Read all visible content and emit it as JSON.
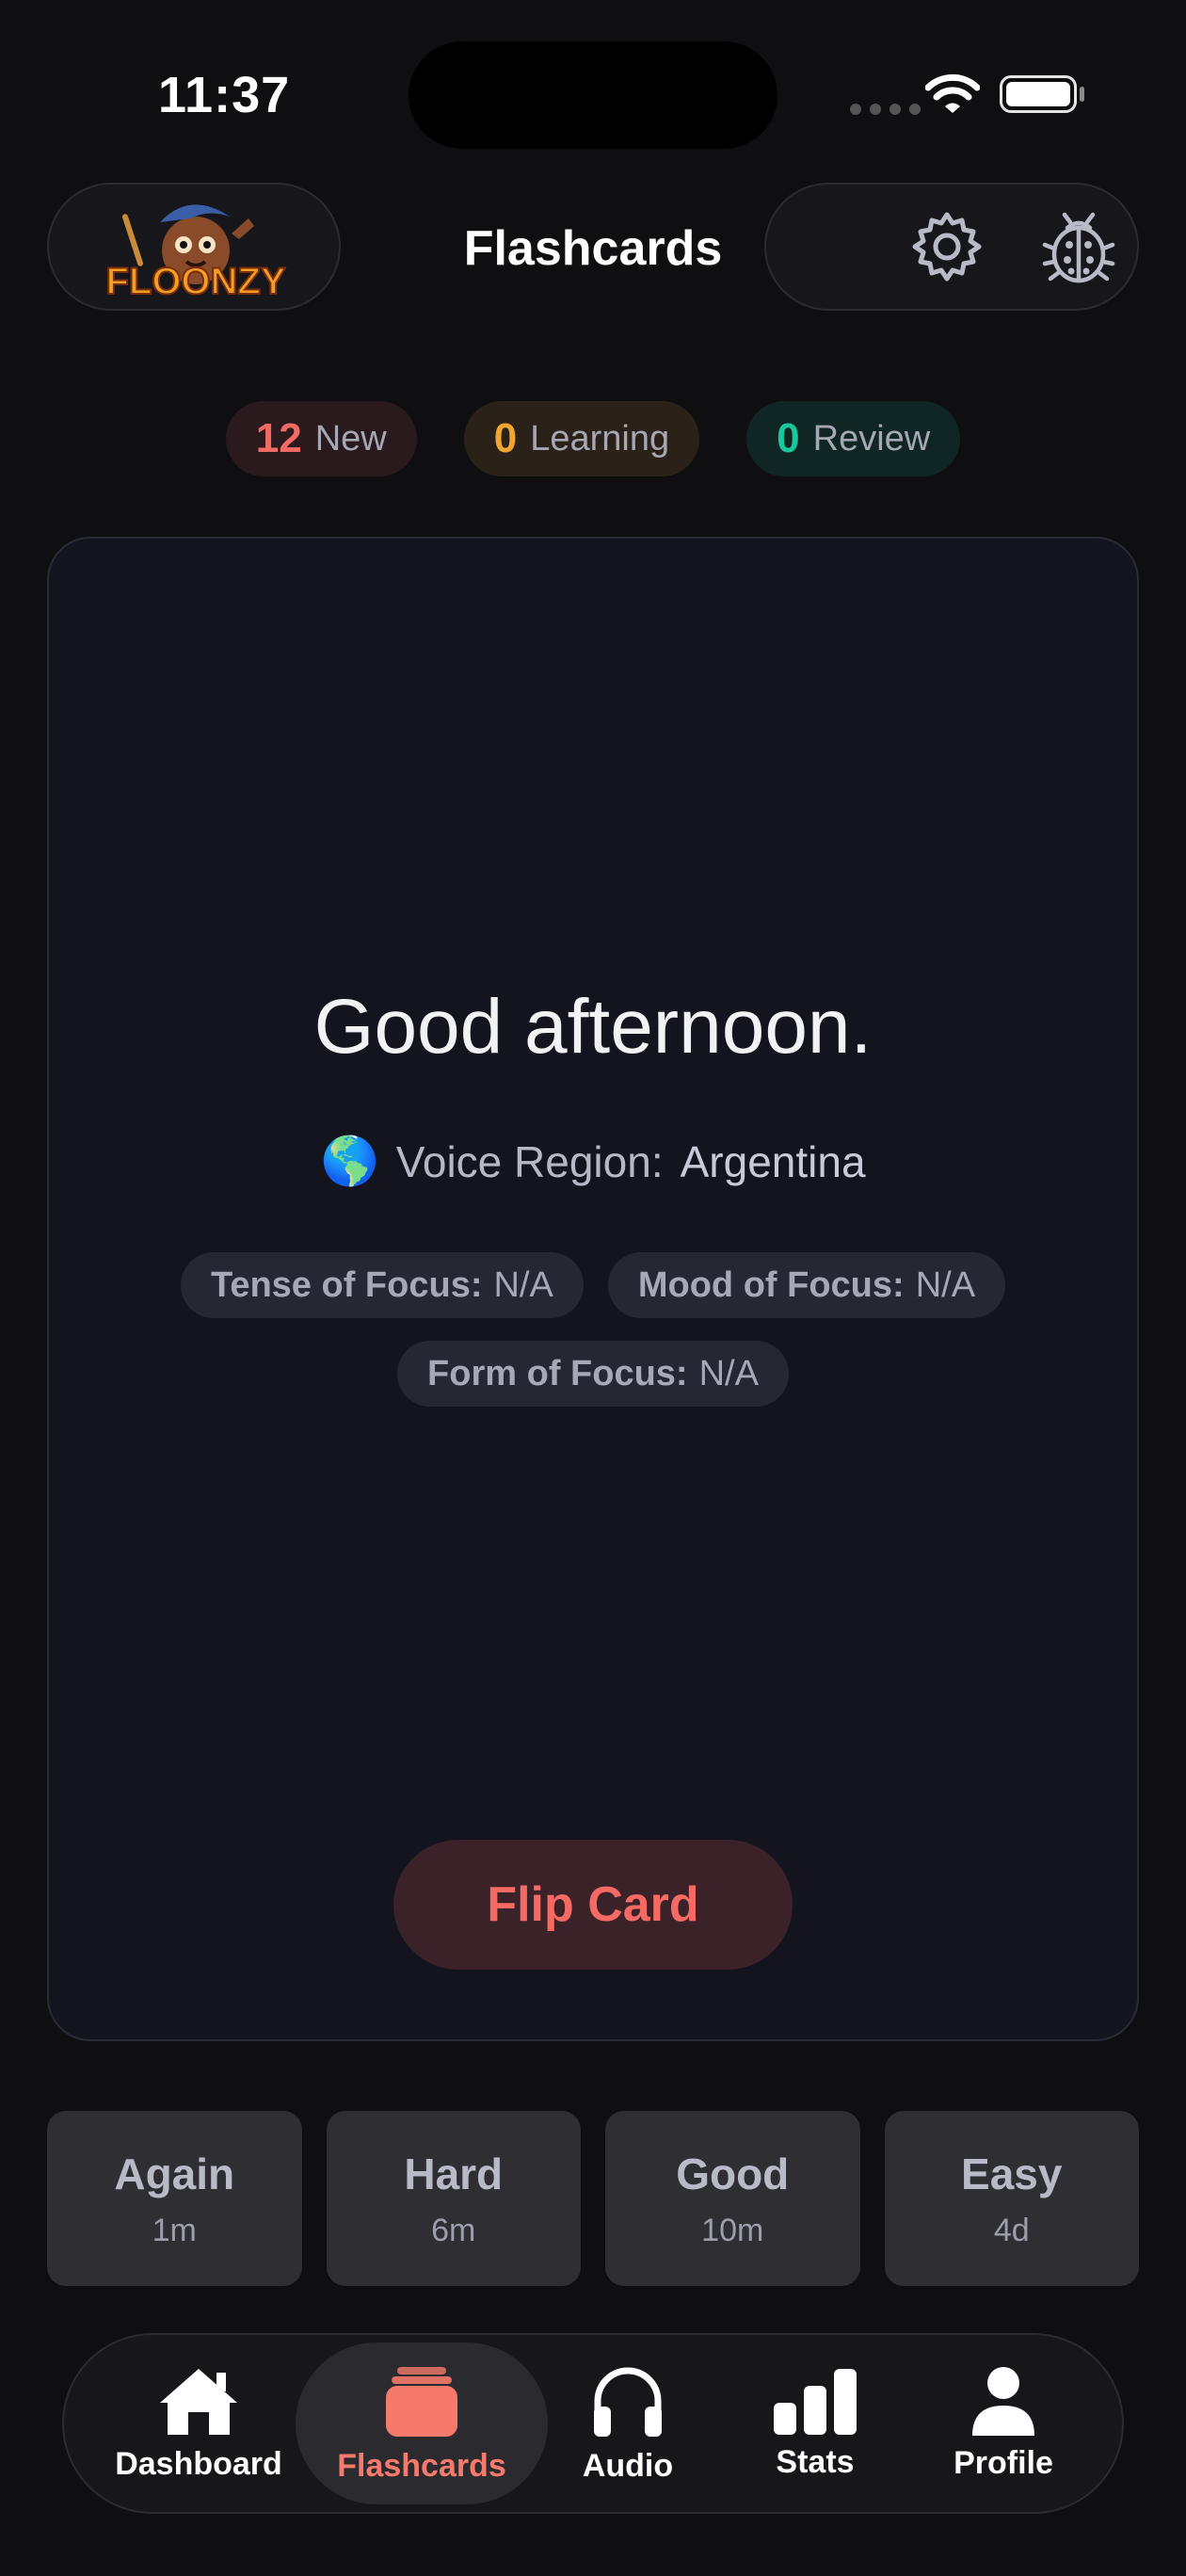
{
  "status_bar": {
    "time": "11:37"
  },
  "header": {
    "title": "Flashcards",
    "logo_text": "FLOONZY",
    "actions": [
      {
        "icon": "gear-icon"
      },
      {
        "icon": "ladybug-icon"
      }
    ]
  },
  "counters": [
    {
      "value": "12",
      "label": "New",
      "color": "#f26b62",
      "bg": "#2a1a1d"
    },
    {
      "value": "0",
      "label": "Learning",
      "color": "#f2a530",
      "bg": "#2a2218"
    },
    {
      "value": "0",
      "label": "Review",
      "color": "#19c79a",
      "bg": "#0f2624"
    }
  ],
  "card": {
    "prompt": "Good afternoon.",
    "region_icon": "🌎",
    "region_label": "Voice Region:",
    "region_value": "Argentina",
    "tags": [
      {
        "label": "Tense of Focus:",
        "value": "N/A"
      },
      {
        "label": "Mood of Focus:",
        "value": "N/A"
      },
      {
        "label": "Form of Focus:",
        "value": "N/A"
      }
    ],
    "flip_label": "Flip Card"
  },
  "grades": [
    {
      "label": "Again",
      "interval": "1m"
    },
    {
      "label": "Hard",
      "interval": "6m"
    },
    {
      "label": "Good",
      "interval": "10m"
    },
    {
      "label": "Easy",
      "interval": "4d"
    }
  ],
  "tabbar": {
    "active": "Flashcards",
    "tabs": [
      {
        "label": "Dashboard",
        "icon": "home-icon"
      },
      {
        "label": "Flashcards",
        "icon": "cards-icon"
      },
      {
        "label": "Audio",
        "icon": "headphones-icon"
      },
      {
        "label": "Stats",
        "icon": "bar-chart-icon"
      },
      {
        "label": "Profile",
        "icon": "person-icon"
      }
    ]
  },
  "colors": {
    "background": "#0f0f12",
    "card": "#14141e",
    "accent": "#f56b63"
  }
}
